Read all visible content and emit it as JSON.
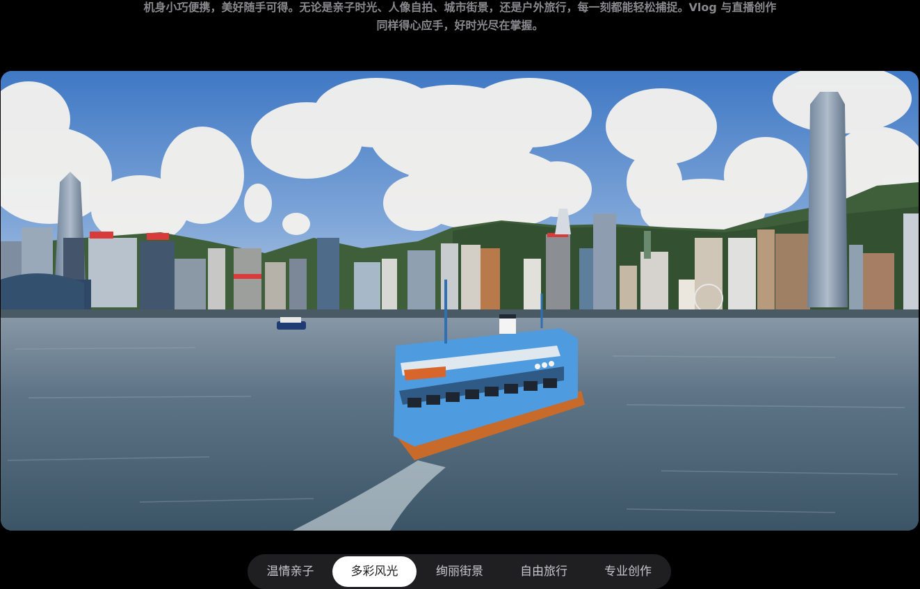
{
  "intro": {
    "line1": "机身小巧便携，美好随手可得。无论是亲子时光、人像自拍、城市街景，还是户外旅行，每一刻都能轻松捕捉。Vlog 与直播创作",
    "line2": "同样得心应手，好时光尽在掌握。"
  },
  "media": {
    "scene": "Harbour ferry crossing in front of a city skyline"
  },
  "tabs": [
    {
      "label": "温情亲子",
      "active": false
    },
    {
      "label": "多彩风光",
      "active": true
    },
    {
      "label": "绚丽街景",
      "active": false
    },
    {
      "label": "自由旅行",
      "active": false
    },
    {
      "label": "专业创作",
      "active": false
    }
  ],
  "colors": {
    "background": "#000000",
    "tab_bar": "#1f1f21",
    "tab_active_bg": "#ffffff",
    "tab_text": "#c7c7cc",
    "intro_text": "#8a8a8e"
  }
}
